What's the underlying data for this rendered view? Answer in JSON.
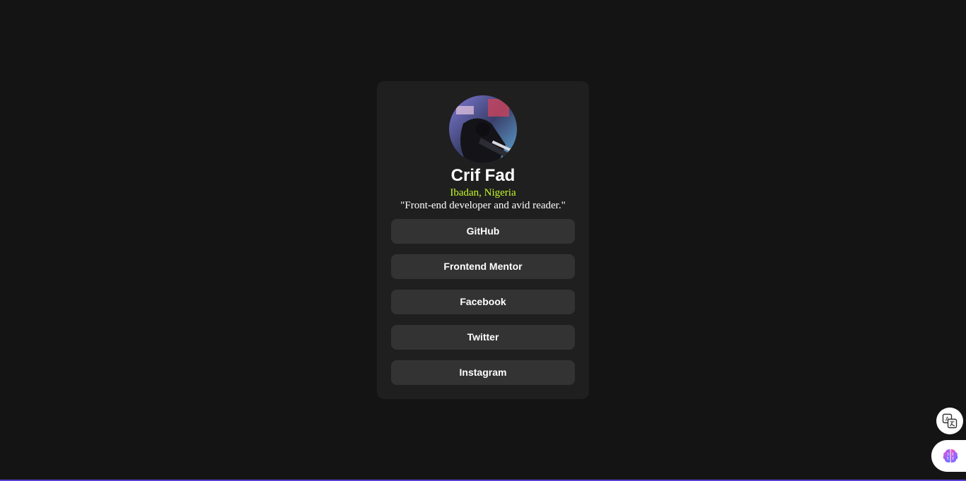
{
  "profile": {
    "name": "Crif Fad",
    "location": "Ibadan, Nigeria",
    "bio": "\"Front-end developer and avid reader.\""
  },
  "links": [
    {
      "label": "GitHub"
    },
    {
      "label": "Frontend Mentor"
    },
    {
      "label": "Facebook"
    },
    {
      "label": "Twitter"
    },
    {
      "label": "Instagram"
    }
  ],
  "theme": {
    "background": "#141414",
    "card": "#1f1f1f",
    "button": "#333333",
    "accent": "#c4f82a"
  },
  "widgets": {
    "translate_icon": "translate-icon",
    "brain_icon": "brain-icon"
  }
}
